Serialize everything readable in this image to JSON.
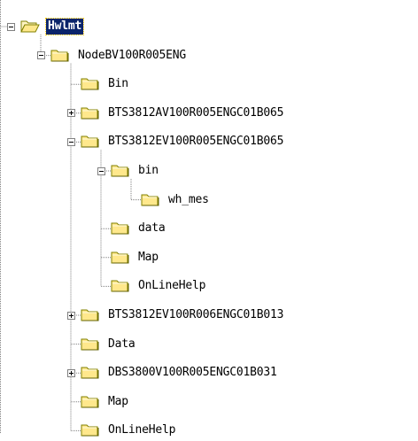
{
  "tree": {
    "nodes": [
      {
        "label": "Hwlmt",
        "depth": 0,
        "expander": "minus",
        "selected": true,
        "open": true
      },
      {
        "label": "NodeBV100R005ENG",
        "depth": 1,
        "expander": "minus",
        "open": true
      },
      {
        "label": "Bin",
        "depth": 2,
        "expander": "none"
      },
      {
        "label": "BTS3812AV100R005ENGC01B065",
        "depth": 2,
        "expander": "plus"
      },
      {
        "label": "BTS3812EV100R005ENGC01B065",
        "depth": 2,
        "expander": "minus",
        "open": true
      },
      {
        "label": "bin",
        "depth": 3,
        "expander": "minus",
        "open": true
      },
      {
        "label": "wh_mes",
        "depth": 4,
        "expander": "none"
      },
      {
        "label": "data",
        "depth": 3,
        "expander": "none"
      },
      {
        "label": "Map",
        "depth": 3,
        "expander": "none"
      },
      {
        "label": "OnLineHelp",
        "depth": 3,
        "expander": "none"
      },
      {
        "label": "BTS3812EV100R006ENGC01B013",
        "depth": 2,
        "expander": "plus"
      },
      {
        "label": "Data",
        "depth": 2,
        "expander": "none"
      },
      {
        "label": "DBS3800V100R005ENGC01B031",
        "depth": 2,
        "expander": "plus"
      },
      {
        "label": "Map",
        "depth": 2,
        "expander": "none"
      },
      {
        "label": "OnLineHelp",
        "depth": 2,
        "expander": "none"
      }
    ]
  },
  "colors": {
    "folder_fill": "#ffe88c",
    "folder_tab": "#fff4c4",
    "folder_outline": "#808000",
    "selection": "#0a246a",
    "lines": "#808080"
  },
  "icons": {
    "folder": "folder-icon",
    "open_folder": "folder-open-icon",
    "expand": "plus-expander-icon",
    "collapse": "minus-expander-icon"
  }
}
